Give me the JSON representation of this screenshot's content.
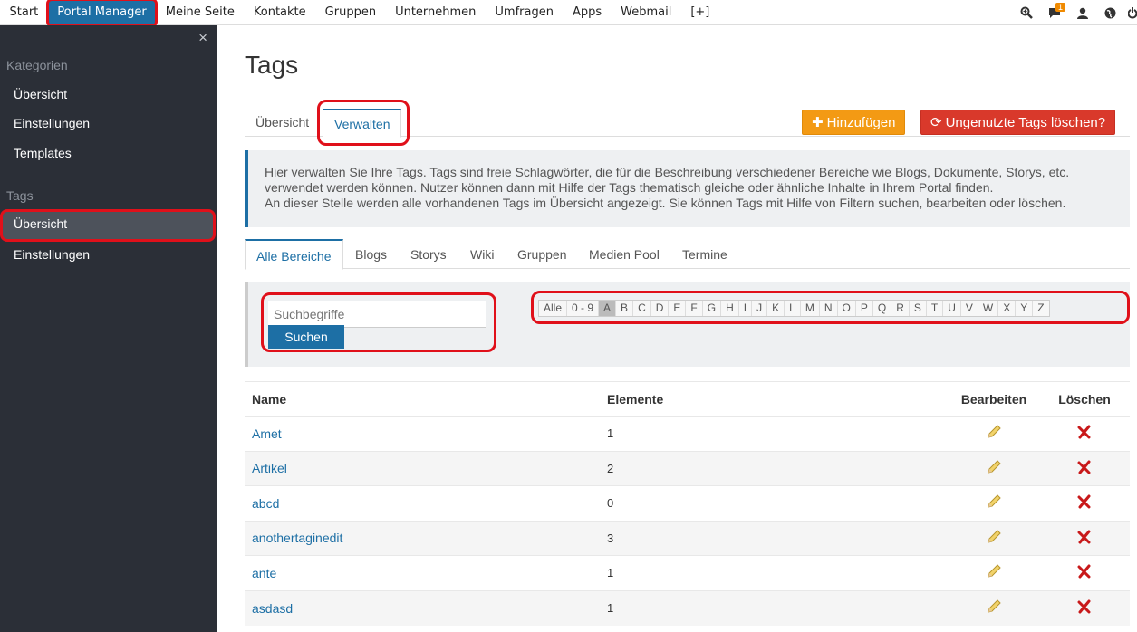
{
  "topnav": {
    "items": [
      "Start",
      "Portal Manager",
      "Meine Seite",
      "Kontakte",
      "Gruppen",
      "Unternehmen",
      "Umfragen",
      "Apps",
      "Webmail",
      "[+]"
    ],
    "active_index": 1,
    "messages_badge": "1",
    "icons": [
      "search-icon",
      "chat-icon",
      "user-icon",
      "globe-icon",
      "power-icon"
    ]
  },
  "sidebar": {
    "close_glyph": "×",
    "section1": "Kategorien",
    "section1_items": [
      "Übersicht",
      "Einstellungen",
      "Templates"
    ],
    "section2": "Tags",
    "section2_items": [
      "Übersicht",
      "Einstellungen"
    ]
  },
  "page": {
    "title": "Tags",
    "tabs": [
      "Übersicht",
      "Verwalten"
    ],
    "active_tab": "Verwalten",
    "add_button": "Hinzufügen",
    "delete_unused_button": "Ungenutzte Tags löschen?",
    "info_lines": [
      "Hier verwalten Sie Ihre Tags. Tags sind freie Schlagwörter, die für die Beschreibung verschiedener Bereiche wie Blogs, Dokumente, Storys, etc.",
      "verwendet werden können. Nutzer können dann mit Hilfe der Tags thematisch gleiche oder ähnliche Inhalte in Ihrem Portal finden.",
      "An dieser Stelle werden alle vorhandenen Tags im Übersicht angezeigt. Sie können Tags mit Hilfe von Filtern suchen, bearbeiten oder löschen."
    ],
    "area_tabs": [
      "Alle Bereiche",
      "Blogs",
      "Storys",
      "Wiki",
      "Gruppen",
      "Medien Pool",
      "Termine"
    ],
    "active_area_tab": "Alle Bereiche",
    "search": {
      "placeholder": "Suchbegriffe",
      "button": "Suchen"
    },
    "alphabet": [
      "Alle",
      "0 - 9",
      "A",
      "B",
      "C",
      "D",
      "E",
      "F",
      "G",
      "H",
      "I",
      "J",
      "K",
      "L",
      "M",
      "N",
      "O",
      "P",
      "Q",
      "R",
      "S",
      "T",
      "U",
      "V",
      "W",
      "X",
      "Y",
      "Z"
    ],
    "alphabet_selected": "A"
  },
  "table": {
    "headers": [
      "Name",
      "Elemente",
      "Bearbeiten",
      "Löschen"
    ],
    "rows": [
      {
        "name": "Amet",
        "count": "1"
      },
      {
        "name": "Artikel",
        "count": "2"
      },
      {
        "name": "abcd",
        "count": "0"
      },
      {
        "name": "anothertaginedit",
        "count": "3"
      },
      {
        "name": "ante",
        "count": "1"
      },
      {
        "name": "asdasd",
        "count": "1"
      }
    ]
  },
  "colors": {
    "accent": "#1d6fa5",
    "sidebar": "#2b2f37",
    "orange": "#f39a14",
    "danger": "#d9392b",
    "highlight": "#e0101a"
  }
}
